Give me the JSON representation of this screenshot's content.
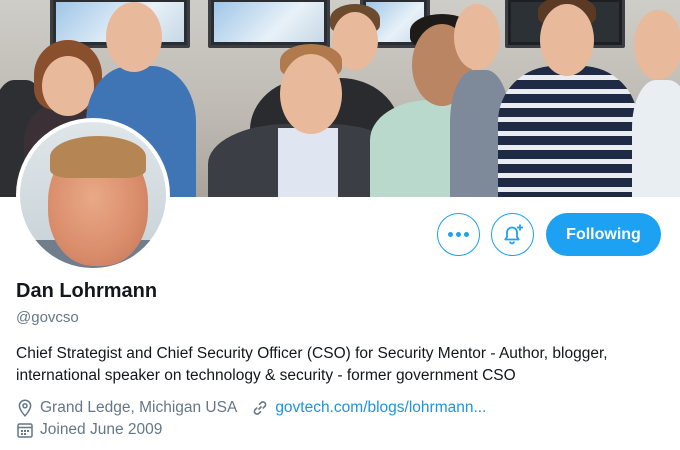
{
  "profile": {
    "name": "Dan Lohrmann",
    "handle": "@govcso",
    "bio": "Chief Strategist and Chief Security Officer (CSO) for Security Mentor - Author, blogger, international speaker on technology & security - former government CSO",
    "location": "Grand Ledge, Michigan  USA",
    "website": "govtech.com/blogs/lohrmann...",
    "joined": "Joined June 2009"
  },
  "actions": {
    "more_icon": "more-horizontal-icon",
    "notify_icon": "bell-plus-icon",
    "follow_label": "Following"
  },
  "icons": {
    "location": "location-pin-icon",
    "link": "link-icon",
    "calendar": "calendar-icon"
  },
  "colors": {
    "accent": "#1da1f2",
    "link": "#1b95e0",
    "secondary_text": "#657786",
    "primary_text": "#14171a"
  }
}
